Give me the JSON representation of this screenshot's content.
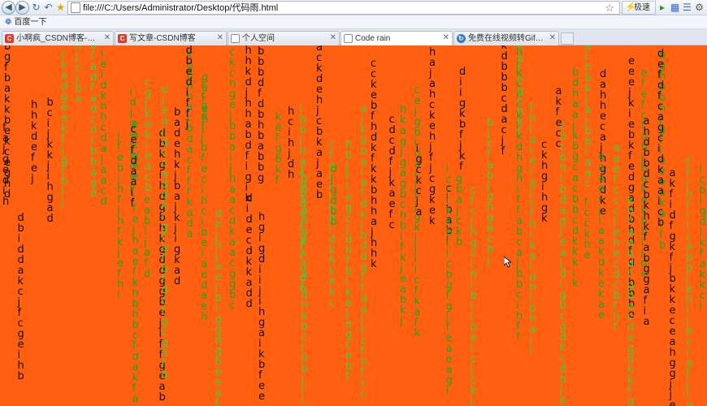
{
  "browser": {
    "url": "file:///C:/Users/Administrator/Desktop/代码雨.html",
    "speed_mode_label": "极速",
    "favorites": [
      {
        "label": "百度一下"
      }
    ],
    "tabs": [
      {
        "title": "小啊疯_CSDN博客-好玩的代码...",
        "icon": "csdn-icon",
        "active": false
      },
      {
        "title": "写文章-CSDN博客",
        "icon": "csdn-icon",
        "active": false
      },
      {
        "title": "个人空间",
        "icon": "page-icon",
        "active": false
      },
      {
        "title": "Code rain",
        "icon": "page-icon",
        "active": true
      },
      {
        "title": "免费在线视频转Gif，动图制作-...",
        "icon": "gif-icon",
        "active": false
      }
    ]
  },
  "rain": {
    "background": "#ff5f0e",
    "colors": {
      "dark": "#111111",
      "green": "#1fa51f",
      "bright": "#3bd13b"
    },
    "alphabet": "abcdefghijk"
  }
}
